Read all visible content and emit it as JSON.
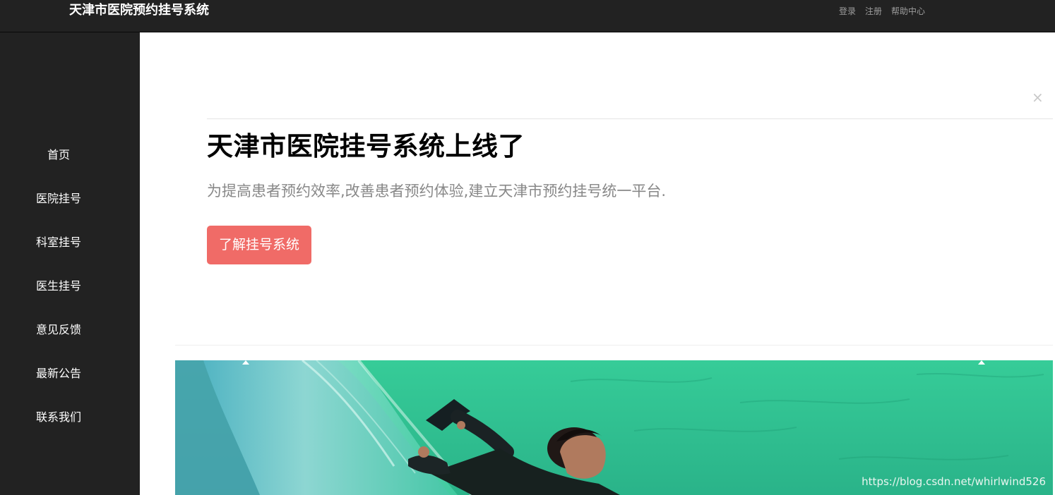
{
  "header": {
    "brand": "天津市医院预约挂号系统",
    "nav": [
      {
        "label": "登录"
      },
      {
        "label": "注册"
      },
      {
        "label": "帮助中心"
      }
    ]
  },
  "sidebar": {
    "items": [
      {
        "label": "首页"
      },
      {
        "label": "医院挂号"
      },
      {
        "label": "科室挂号"
      },
      {
        "label": "医生挂号"
      },
      {
        "label": "意见反馈"
      },
      {
        "label": "最新公告"
      },
      {
        "label": "联系我们"
      }
    ]
  },
  "hero": {
    "close": "×",
    "title": "天津市医院挂号系统上线了",
    "subtitle": "为提高患者预约效率,改善患者预约体验,建立天津市预约挂号统一平台.",
    "button_label": "了解挂号系统"
  },
  "carousel": {
    "image": "surfer-on-wave",
    "watermark": "https://blog.csdn.net/whirlwind526"
  },
  "colors": {
    "dark_bg": "#222222",
    "button_accent": "#f06b67",
    "wave": "#2fcf9c"
  }
}
